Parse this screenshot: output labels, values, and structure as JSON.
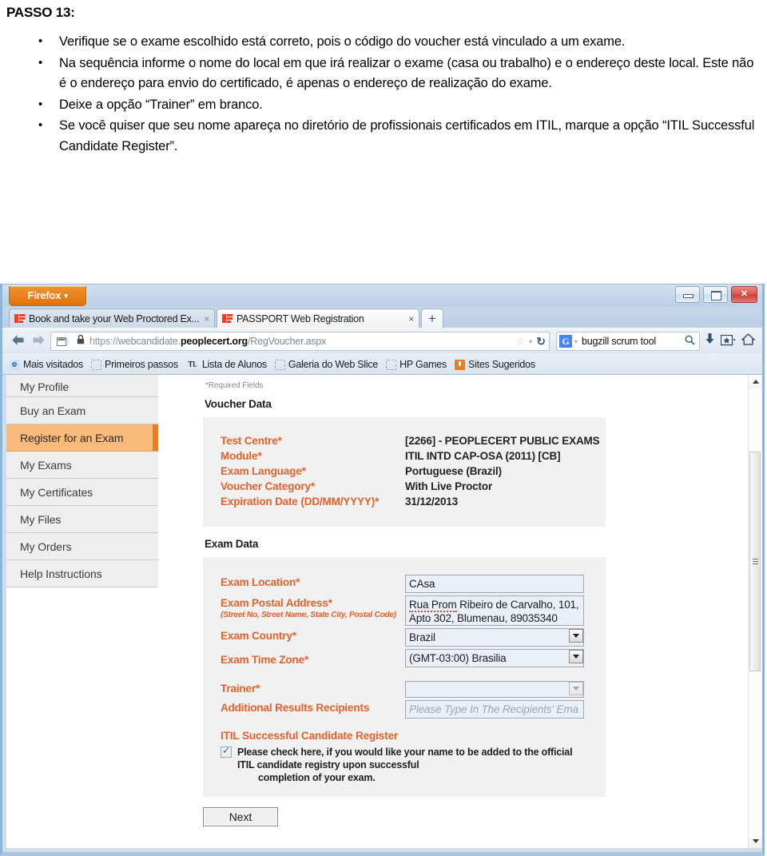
{
  "doc": {
    "title": "PASSO 13:",
    "bullets": [
      "Verifique se o exame escolhido está correto, pois o código do voucher está vinculado a um exame.",
      "Na sequência informe o nome do local em que irá realizar o exame (casa ou trabalho) e o endereço deste local. Este não é o endereço para envio do certificado, é apenas o endereço de realização do exame.",
      "Deixe a opção “Trainer” em branco.",
      "Se você quiser que seu nome apareça no diretório de profissionais certificados em ITIL, marque a opção “ITIL Successful Candidate Register”."
    ]
  },
  "browser": {
    "app_menu_label": "Firefox",
    "app_menu_caret": "▾",
    "window_controls": {
      "minimize": "minimize-icon",
      "maximize": "maximize-icon",
      "close": "✕"
    },
    "tabs": [
      {
        "title": "Book and take your Web Proctored Ex...",
        "close": "×",
        "active": false
      },
      {
        "title": "PASSPORT Web Registration",
        "close": "×",
        "active": true
      }
    ],
    "new_tab_label": "+",
    "nav": {
      "back": "←",
      "forward": "→",
      "url_scheme": "https://",
      "url_subdomain": "webcandidate.",
      "url_domain": "peoplecert.org",
      "url_path": "/RegVoucher.aspx",
      "star": "☆",
      "dropdown": "▾",
      "reload": "↻",
      "search_engine": "G",
      "search_query": "bugzill scrum tool",
      "search_magnify": "⌕",
      "download": "↓",
      "bookmarks_star": "★",
      "home": "⌂"
    },
    "bookmarks": [
      {
        "label": "Mais visitados",
        "icon": "blue"
      },
      {
        "label": "Primeiros passos",
        "icon": "dashed"
      },
      {
        "label": "Lista de Alunos",
        "icon": "ti"
      },
      {
        "label": "Galeria do Web Slice",
        "icon": "dashed"
      },
      {
        "label": "HP Games",
        "icon": "dashed"
      },
      {
        "label": "Sites Sugeridos",
        "icon": "orange"
      }
    ]
  },
  "page": {
    "sidebar": [
      {
        "label": "My Profile",
        "active": false
      },
      {
        "label": "Buy an Exam",
        "active": false
      },
      {
        "label": "Register for an Exam",
        "active": true
      },
      {
        "label": "My Exams",
        "active": false
      },
      {
        "label": "My Certificates",
        "active": false
      },
      {
        "label": "My Files",
        "active": false
      },
      {
        "label": "My Orders",
        "active": false
      },
      {
        "label": "Help Instructions",
        "active": false
      }
    ],
    "required_note": "*Required Fields",
    "voucher_section_title": "Voucher Data",
    "voucher_rows": [
      {
        "label": "Test Centre*",
        "value": "[2266] - PEOPLECERT PUBLIC EXAMS"
      },
      {
        "label": "Module*",
        "value": "ITIL INTD CAP-OSA (2011) [CB]"
      },
      {
        "label": "Exam Language*",
        "value": "Portuguese (Brazil)"
      },
      {
        "label": "Voucher Category*",
        "value": "With Live Proctor"
      },
      {
        "label": "Expiration Date (DD/MM/YYYY)*",
        "value": "31/12/2013"
      }
    ],
    "exam_section_title": "Exam Data",
    "exam_location_label": "Exam Location*",
    "exam_location_value": "CAsa",
    "exam_postal_label": "Exam Postal Address*",
    "exam_postal_sublabel": "(Street No, Street Name, State City, Postal Code)",
    "exam_postal_value_line1_a": "Rua Prom",
    "exam_postal_value_line1_b": " Ribeiro de Carvalho, 101,",
    "exam_postal_value_line2": "Apto 302, Blumenau, 89035340",
    "exam_country_label": "Exam Country*",
    "exam_country_value": "Brazil",
    "exam_timezone_label": "Exam Time Zone*",
    "exam_timezone_value": "(GMT-03:00) Brasilia",
    "trainer_label": "Trainer*",
    "trainer_value": "",
    "additional_recipients_label": "Additional Results Recipients",
    "additional_recipients_placeholder": "Please Type In The Recipients' Ema",
    "itil_register_title": "ITIL Successful Candidate Register",
    "itil_checkbox_checked": true,
    "itil_checkbox_text_line1": "Please check here, if you would like your name to be added to the official ITIL",
    "itil_checkbox_text_line2": "candidate registry upon successful",
    "itil_checkbox_text_line3": "completion of your exam.",
    "next_button": "Next"
  },
  "colors": {
    "accent_orange": "#e2622c",
    "nav_active_bg": "#f9ba7b",
    "nav_active_marker": "#f07c18",
    "field_bg": "#eaf0f8",
    "panel_bg": "#f1f1f1"
  }
}
